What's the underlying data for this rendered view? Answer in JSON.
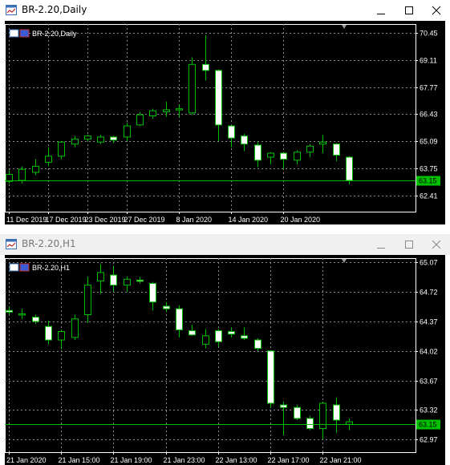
{
  "windows": [
    {
      "title": "BR-2.20,Daily",
      "label": "BR-2.20,Daily",
      "active": true,
      "buttons": [
        "minimize-icon",
        "maximize-icon",
        "close-icon"
      ],
      "colors": {
        "bull": "#00c000",
        "bear": "#ffffff",
        "current": "#00c000"
      },
      "price_axis": [
        "70.45",
        "69.11",
        "67.77",
        "66.43",
        "65.09",
        "63.75",
        "62.41"
      ],
      "current_price": "63.15",
      "time_axis": [
        "11 Dec 2019",
        "17 Dec 2019",
        "23 Dec 2019",
        "27 Dec 2019",
        "8 Jan 2020",
        "14 Jan 2020",
        "20 Jan 2020"
      ],
      "chart_data": {
        "type": "candlestick",
        "ylim": [
          61.6,
          70.9
        ],
        "current": 63.15,
        "candles": [
          {
            "o": 63.1,
            "h": 63.65,
            "l": 63.0,
            "c": 63.45
          },
          {
            "o": 63.15,
            "h": 63.85,
            "l": 63.0,
            "c": 63.7
          },
          {
            "o": 63.55,
            "h": 64.2,
            "l": 63.4,
            "c": 63.85
          },
          {
            "o": 64.05,
            "h": 64.8,
            "l": 63.85,
            "c": 64.35
          },
          {
            "o": 64.35,
            "h": 65.1,
            "l": 64.2,
            "c": 65.05
          },
          {
            "o": 64.95,
            "h": 65.35,
            "l": 64.8,
            "c": 65.2
          },
          {
            "o": 65.2,
            "h": 65.4,
            "l": 65.1,
            "c": 65.35
          },
          {
            "o": 65.05,
            "h": 65.4,
            "l": 64.95,
            "c": 65.3
          },
          {
            "o": 65.3,
            "h": 65.35,
            "l": 65.0,
            "c": 65.15
          },
          {
            "o": 65.3,
            "h": 66.0,
            "l": 65.1,
            "c": 65.85
          },
          {
            "o": 65.9,
            "h": 66.55,
            "l": 65.85,
            "c": 66.4
          },
          {
            "o": 66.35,
            "h": 66.7,
            "l": 66.2,
            "c": 66.6
          },
          {
            "o": 66.55,
            "h": 67.05,
            "l": 66.3,
            "c": 66.65
          },
          {
            "o": 66.65,
            "h": 66.9,
            "l": 66.3,
            "c": 66.7
          },
          {
            "o": 66.5,
            "h": 69.25,
            "l": 66.4,
            "c": 68.9
          },
          {
            "o": 68.9,
            "h": 70.35,
            "l": 68.1,
            "c": 68.6
          },
          {
            "o": 68.6,
            "h": 68.65,
            "l": 65.1,
            "c": 65.9
          },
          {
            "o": 65.85,
            "h": 65.9,
            "l": 64.8,
            "c": 65.25
          },
          {
            "o": 65.35,
            "h": 65.45,
            "l": 64.6,
            "c": 64.95
          },
          {
            "o": 64.9,
            "h": 65.05,
            "l": 63.8,
            "c": 64.15
          },
          {
            "o": 64.3,
            "h": 64.55,
            "l": 63.95,
            "c": 64.5
          },
          {
            "o": 64.5,
            "h": 64.55,
            "l": 63.7,
            "c": 64.2
          },
          {
            "o": 64.15,
            "h": 64.65,
            "l": 63.95,
            "c": 64.55
          },
          {
            "o": 64.55,
            "h": 64.95,
            "l": 64.3,
            "c": 64.85
          },
          {
            "o": 64.95,
            "h": 65.4,
            "l": 64.5,
            "c": 65.05
          },
          {
            "o": 64.95,
            "h": 65.0,
            "l": 64.1,
            "c": 64.4
          },
          {
            "o": 64.3,
            "h": 64.35,
            "l": 62.95,
            "c": 63.15
          }
        ]
      },
      "time_tick_candles": [
        0,
        3,
        6,
        9,
        13,
        17,
        21
      ]
    },
    {
      "title": "BR-2.20,H1",
      "label": "BR-2.20,H1",
      "active": false,
      "buttons": [
        "minimize-icon",
        "maximize-icon",
        "close-icon"
      ],
      "colors": {
        "bull": "#00c000",
        "bear": "#ffffff",
        "current": "#00c000"
      },
      "price_axis": [
        "65.07",
        "64.72",
        "64.37",
        "64.02",
        "63.67",
        "63.32",
        "62.97"
      ],
      "current_price": "63.15",
      "time_axis": [
        "21 Jan 2020",
        "21 Jan 15:00",
        "21 Jan 19:00",
        "21 Jan 23:00",
        "22 Jan 13:00",
        "22 Jan 17:00",
        "22 Jan 21:00"
      ],
      "chart_data": {
        "type": "candlestick",
        "ylim": [
          62.82,
          65.12
        ],
        "current": 63.15,
        "candles": [
          {
            "o": 64.5,
            "h": 64.55,
            "l": 64.45,
            "c": 64.48
          },
          {
            "o": 64.45,
            "h": 64.52,
            "l": 64.4,
            "c": 64.46
          },
          {
            "o": 64.42,
            "h": 64.45,
            "l": 64.34,
            "c": 64.37
          },
          {
            "o": 64.31,
            "h": 64.38,
            "l": 64.1,
            "c": 64.15
          },
          {
            "o": 64.15,
            "h": 64.27,
            "l": 64.04,
            "c": 64.25
          },
          {
            "o": 64.18,
            "h": 64.45,
            "l": 64.15,
            "c": 64.4
          },
          {
            "o": 64.45,
            "h": 64.9,
            "l": 64.35,
            "c": 64.8
          },
          {
            "o": 64.85,
            "h": 65.05,
            "l": 64.7,
            "c": 64.95
          },
          {
            "o": 64.92,
            "h": 65.03,
            "l": 64.72,
            "c": 64.8
          },
          {
            "o": 64.8,
            "h": 64.9,
            "l": 64.72,
            "c": 64.87
          },
          {
            "o": 64.86,
            "h": 64.9,
            "l": 64.82,
            "c": 64.85
          },
          {
            "o": 64.82,
            "h": 64.84,
            "l": 64.5,
            "c": 64.6
          },
          {
            "o": 64.55,
            "h": 64.6,
            "l": 64.48,
            "c": 64.52
          },
          {
            "o": 64.52,
            "h": 64.56,
            "l": 64.18,
            "c": 64.27
          },
          {
            "o": 64.26,
            "h": 64.33,
            "l": 64.2,
            "c": 64.21
          },
          {
            "o": 64.1,
            "h": 64.28,
            "l": 64.05,
            "c": 64.2
          },
          {
            "o": 64.26,
            "h": 64.28,
            "l": 64.07,
            "c": 64.13
          },
          {
            "o": 64.25,
            "h": 64.3,
            "l": 64.18,
            "c": 64.22
          },
          {
            "o": 64.2,
            "h": 64.3,
            "l": 64.15,
            "c": 64.17
          },
          {
            "o": 64.15,
            "h": 64.17,
            "l": 64.02,
            "c": 64.05
          },
          {
            "o": 64.02,
            "h": 64.03,
            "l": 63.35,
            "c": 63.4
          },
          {
            "o": 63.38,
            "h": 63.42,
            "l": 63.02,
            "c": 63.35
          },
          {
            "o": 63.35,
            "h": 63.38,
            "l": 63.2,
            "c": 63.22
          },
          {
            "o": 63.22,
            "h": 63.25,
            "l": 63.08,
            "c": 63.1
          },
          {
            "o": 63.1,
            "h": 63.42,
            "l": 62.97,
            "c": 63.4
          },
          {
            "o": 63.38,
            "h": 63.47,
            "l": 63.05,
            "c": 63.2
          },
          {
            "o": 63.15,
            "h": 63.22,
            "l": 63.08,
            "c": 63.18
          }
        ]
      },
      "time_tick_candles": [
        0,
        4,
        8,
        12,
        16,
        20,
        24
      ]
    }
  ]
}
